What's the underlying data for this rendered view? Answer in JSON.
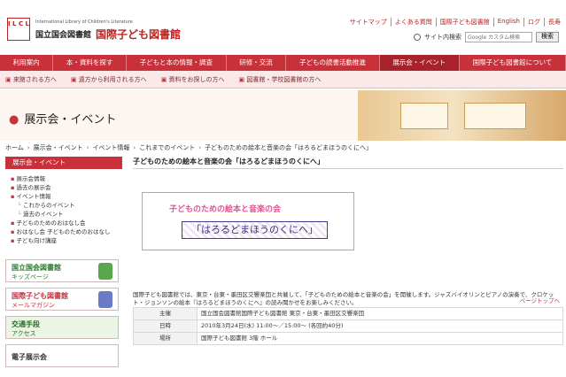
{
  "header": {
    "logo_mark": "I L C L",
    "logo_en": "International Library of Children's Literature",
    "logo_ja_org": "国立国会図書館",
    "logo_ja_name": "国際子ども図書館",
    "top_links": [
      "サイトマップ",
      "よくある質問",
      "国際子ども図書館",
      "English",
      "ログ",
      "長寿"
    ],
    "search_label": "サイト内検索",
    "search_placeholder": "Google カスタム検索",
    "search_button": "検索"
  },
  "main_nav": [
    "利用案内",
    "本・資料を探す",
    "子どもと本の情報・調査",
    "研修・交流",
    "子どもの読書活動推進",
    "展示会・イベント",
    "国際子ども図書館について"
  ],
  "main_nav_active": "展示会・イベント",
  "sub_nav": [
    "来館される方へ",
    "遠方から利用される方へ",
    "資料をお探しの方へ",
    "図書館・学校図書館の方へ"
  ],
  "banner": {
    "title": "展示会・イベント"
  },
  "breadcrumb": [
    "ホーム",
    "展示会・イベント",
    "イベント情報",
    "これまでのイベント",
    "子どものための絵本と音楽の会「はろるどまほうのくにへ」"
  ],
  "sidebar": {
    "heading": "展示会・イベント",
    "items": [
      {
        "label": "展示会情報",
        "sub": false
      },
      {
        "label": "過去の展示会",
        "sub": false
      },
      {
        "label": "イベント情報",
        "sub": false
      },
      {
        "label": "これからのイベント",
        "sub": true
      },
      {
        "label": "過去のイベント",
        "sub": true
      },
      {
        "label": "子どものためのおはなし会",
        "sub": false
      },
      {
        "label": "おはなし会 子どものためのおはなし",
        "sub": false
      },
      {
        "label": "子ども向け講座",
        "sub": false
      }
    ],
    "banners": [
      {
        "line1": "国立国会図書館",
        "line2": "キッズページ"
      },
      {
        "line1": "国際子ども図書館",
        "line2": "メールマガジン"
      },
      {
        "line1": "交通手段",
        "line2": "アクセス"
      },
      {
        "line1": "電子展示会",
        "line2": ""
      }
    ]
  },
  "content": {
    "title": "子どものための絵本と音楽の会「はろるどまほうのくにへ」",
    "poster_title": "子どものための絵本と音楽の会",
    "poster_subtitle": "「はろるどまほうのくにへ」",
    "description": "国際子ども図書館では、東京・台東・墨田区交響楽団と共催して、「子どものための絵本と音楽の会」を開催します。ジャズバイオリンとピアノの演奏で、クロケット・ジョンソンの絵本『はろるどまほうのくにへ』の読み聞かせをお楽しみください。",
    "page_top": "ページトップへ",
    "table": [
      {
        "key": "主催",
        "value": "国立国会図書館国際子ども図書館 東京・台東・墨田区交響楽団"
      },
      {
        "key": "日時",
        "value": "2010年3月24日(水) 11:00〜／15:00〜 (各回約40分)"
      },
      {
        "key": "場所",
        "value": "国際子ども図書館 3階 ホール"
      }
    ]
  }
}
